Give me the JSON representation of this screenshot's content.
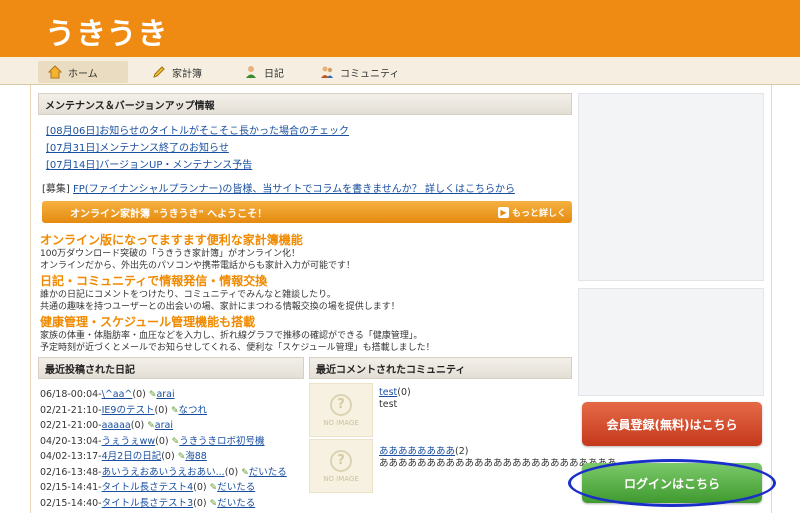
{
  "brand": {
    "logo_text": "うきうき",
    "color": "#ef8a12"
  },
  "nav": {
    "items": [
      {
        "label": "ホーム",
        "icon": "home-icon",
        "active": true
      },
      {
        "label": "家計簿",
        "icon": "pencil-icon"
      },
      {
        "label": "日記",
        "icon": "person-icon"
      },
      {
        "label": "コミュニティ",
        "icon": "group-icon"
      }
    ]
  },
  "maintenance": {
    "title": "メンテナンス＆バージョンアップ情報",
    "items": [
      "[08月06日]お知らせのタイトルがそこそこ長かった場合のチェック",
      "[07月31日]メンテナンス終了のお知らせ",
      "[07月14日]バージョンUP・メンテナンス予告"
    ],
    "recruit_prefix": "[募集]",
    "recruit_link": "FP(ファイナンシャルプランナー)の皆様、当サイトでコラムを書きませんか？ 詳しくはこちらから"
  },
  "welcome": {
    "text": "オンライン家計簿 \"うきうき\" へようこそ！",
    "more": "もっと詳しく"
  },
  "features": [
    {
      "title": "オンライン版になってますます便利な家計簿機能",
      "lines": [
        "100万ダウンロード突破の「うきうき家計簿」がオンライン化！",
        "オンラインだから、外出先のパソコンや携帯電話からも家計入力が可能です！"
      ]
    },
    {
      "title": "日記・コミュニティで情報発信・情報交換",
      "lines": [
        "誰かの日記にコメントをつけたり、コミュニティでみんなと雑談したり。",
        "共通の趣味を持つユーザーとの出会いの場、家計にまつわる情報交換の場を提供します！"
      ]
    },
    {
      "title": "健康管理・スケジュール管理機能も搭載",
      "lines": [
        "家族の体重・体脂肪率・血圧などを入力し、折れ線グラフで推移の確認ができる「健康管理」。",
        "予定時刻が近づくとメールでお知らせしてくれる、便利な「スケジュール管理」も搭載しました！"
      ]
    }
  ],
  "recent_diaries": {
    "title": "最近投稿された日記",
    "rows": [
      {
        "date": "06/18-00:04-",
        "title": "\\^aa^",
        "count": "(0)",
        "user": "arai"
      },
      {
        "date": "02/21-21:10-",
        "title": "IE9のテスト",
        "count": "(0)",
        "user": "なつれ"
      },
      {
        "date": "02/21-21:00-",
        "title": "aaaaa",
        "count": "(0)",
        "user": "arai"
      },
      {
        "date": "04/20-13:04-",
        "title": "うぇうぇww",
        "count": "(0)",
        "user": "うきうきロボ初号機"
      },
      {
        "date": "04/02-13:17-",
        "title": "4月2日の日記",
        "count": "(0)",
        "user": "海88"
      },
      {
        "date": "02/16-13:48-",
        "title": "あいうえおあいうえおあい...",
        "count": "(0)",
        "user": "だいたる"
      },
      {
        "date": "02/15-14:41-",
        "title": "タイトル長さテスト4",
        "count": "(0)",
        "user": "だいたる"
      },
      {
        "date": "02/15-14:40-",
        "title": "タイトル長さテスト3",
        "count": "(0)",
        "user": "だいたる"
      }
    ]
  },
  "recent_communities": {
    "title": "最近コメントされたコミュニティ",
    "noimage": "NO IMAGE",
    "items": [
      {
        "title": "test",
        "count": "(0)",
        "desc": "test"
      },
      {
        "title": "ああああああああ",
        "count": "(2)",
        "desc": "あああああああああああああああああああああああああ"
      }
    ]
  },
  "buttons": {
    "register": "会員登録(無料)はこちら",
    "login": "ログインはこちら"
  }
}
